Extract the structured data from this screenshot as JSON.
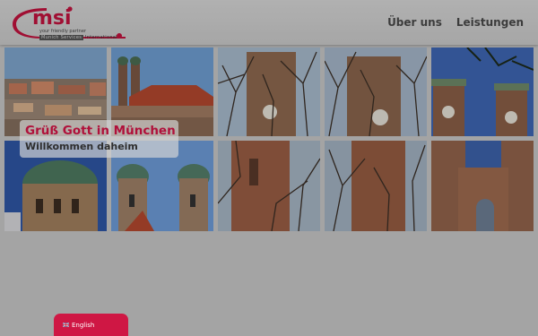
{
  "header": {
    "logo": {
      "wordmark": "msi",
      "tagline": "your friendly partner",
      "name_part1": "Munich Services",
      "name_part2": "International"
    },
    "nav": [
      {
        "label": "Über uns"
      },
      {
        "label": "Leistungen"
      }
    ]
  },
  "hero": {
    "title": "Grüß Gott in München",
    "subtitle": "Willkommen daheim"
  },
  "language_button": {
    "label": "English",
    "flag": "uk-flag-icon"
  },
  "colors": {
    "brand_red": "#c4133f",
    "language_tab": "#cf1744",
    "page_background": "#c9c9c9"
  },
  "gallery": {
    "photos": [
      "munich-skyline-photo",
      "frauenkirche-roof-photo",
      "frauenkirche-tower-photo",
      "frauenkirche-tower-photo",
      "frauenkirche-towers-sky-photo",
      "frauenkirche-dome-photo",
      "frauenkirche-twin-towers-photo",
      "frauenkirche-tower-lower-photo",
      "frauenkirche-tower-lower-photo",
      "frauenkirche-facade-photo"
    ]
  }
}
